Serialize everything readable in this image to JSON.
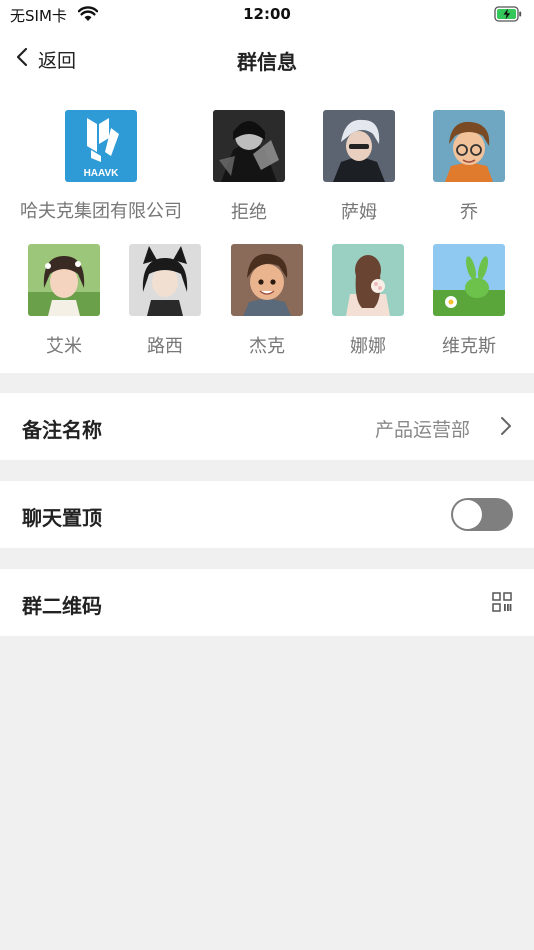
{
  "status_bar": {
    "carrier": "无SIM卡",
    "time": "12:00"
  },
  "nav": {
    "back_label": "返回",
    "title": "群信息"
  },
  "members": [
    {
      "name": "哈夫克集团有限公司",
      "avatar": "haavk-logo",
      "logo_text": "HAAVK"
    },
    {
      "name": "拒绝",
      "avatar": "dark-figure"
    },
    {
      "name": "萨姆",
      "avatar": "silver-hair-boy"
    },
    {
      "name": "乔",
      "avatar": "glasses-boy"
    },
    {
      "name": "艾米",
      "avatar": "flower-girl"
    },
    {
      "name": "路西",
      "avatar": "cat-ear-girl"
    },
    {
      "name": "杰克",
      "avatar": "smiling-boy"
    },
    {
      "name": "娜娜",
      "avatar": "back-view-girl"
    },
    {
      "name": "维克斯",
      "avatar": "green-bunny"
    }
  ],
  "settings": {
    "remark": {
      "label": "备注名称",
      "value": "产品运营部"
    },
    "pin_chat": {
      "label": "聊天置顶",
      "enabled": false
    },
    "qr_code": {
      "label": "群二维码"
    }
  }
}
